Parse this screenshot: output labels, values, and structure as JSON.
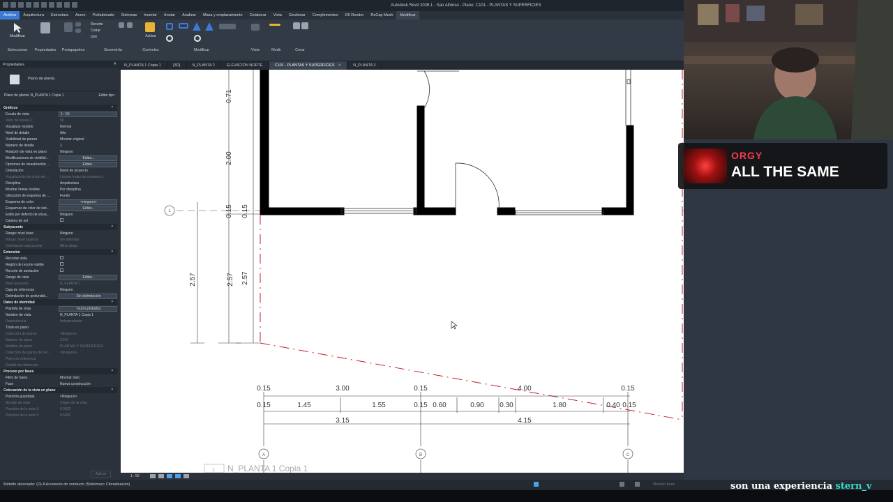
{
  "window": {
    "title": "Autodesk Revit 2026.1 - San Alfonso - Plano: C101 - PLANTAS Y SUPERFICIES"
  },
  "menu": [
    "Archivo",
    "Arquitectura",
    "Estructura",
    "Acero",
    "Prefabricado",
    "Sistemas",
    "Insertar",
    "Anotar",
    "Analizar",
    "Masa y emplazamiento",
    "Colaborar",
    "Vista",
    "Gestionar",
    "Complementos",
    "D5 Render",
    "ReCap Mesh",
    "Modificar"
  ],
  "ribbon": {
    "select": "Seleccionar",
    "modify": "Modificar",
    "properties": "Propiedades",
    "clipboard": "Portapapeles",
    "geometry": "Geometría",
    "controls": "Controles",
    "activate": "Activar",
    "modify_group": "Modificar",
    "view": "Vista",
    "measure": "Medir",
    "create": "Crear",
    "cut_labels": [
      "Recorte",
      "Cortar",
      "Unir"
    ]
  },
  "tabs": [
    {
      "label": "N_PLANTA 1 Copia 1",
      "active": false
    },
    {
      "label": "{3D}",
      "active": false
    },
    {
      "label": "N_PLANTA 2",
      "active": false
    },
    {
      "label": "ELEVACIÓN NORTE",
      "active": false
    },
    {
      "label": "C101 - PLANTAS Y SUPERFICIES",
      "active": true
    },
    {
      "label": "N_PLANTA 3",
      "active": false
    }
  ],
  "properties": {
    "header": "Propiedades",
    "type_name": "Plano de planta",
    "filter": "Plano de planta: N_PLANTA 1 Copia 1",
    "edit_type": "Editar tipo",
    "rows": [
      {
        "cat": "Gráficos"
      },
      {
        "k": "Escala de vista",
        "v": "1 : 50",
        "style": "box"
      },
      {
        "k": "Valor de escala    1:",
        "v": "50",
        "dim": true
      },
      {
        "k": "Visualizar modelo",
        "v": "Normal"
      },
      {
        "k": "Nivel de detalle",
        "v": "Alto"
      },
      {
        "k": "Visibilidad de piezas",
        "v": "Mostrar original"
      },
      {
        "k": "Número de detalle",
        "v": "1"
      },
      {
        "k": "Rotación de vista en plano",
        "v": "Ninguno"
      },
      {
        "k": "Modificaciones de visibilid...",
        "v": "Editar...",
        "style": "btn"
      },
      {
        "k": "Opciones de visualización ...",
        "v": "Editar...",
        "style": "btn"
      },
      {
        "k": "Orientación",
        "v": "Norte de proyecto"
      },
      {
        "k": "Visualización de unión de ...",
        "v": "Limpiar todas las uniones d...",
        "dim": true
      },
      {
        "k": "Disciplina",
        "v": "Arquitectura"
      },
      {
        "k": "Mostrar líneas ocultas",
        "v": "Por disciplina"
      },
      {
        "k": "Ubicación de esquema de ...",
        "v": "Fondo"
      },
      {
        "k": "Esquema de color",
        "v": "<ninguno>",
        "style": "btn"
      },
      {
        "k": "Esquemas de color de sist...",
        "v": "Editar...",
        "style": "btn"
      },
      {
        "k": "Estilo por defecto de visua...",
        "v": "Ninguno"
      },
      {
        "k": "Camino de sol",
        "v": "",
        "style": "chk"
      },
      {
        "cat": "Subyacente"
      },
      {
        "k": "Rango: nivel base",
        "v": "Ninguno"
      },
      {
        "k": "Rango: nivel superior",
        "v": "Sin delimitar",
        "dim": true
      },
      {
        "k": "Orientación subyacente",
        "v": "Mirar abajo",
        "dim": true
      },
      {
        "cat": "Extensión"
      },
      {
        "k": "Recortar vista",
        "v": "",
        "style": "chk"
      },
      {
        "k": "Región de recorte visible",
        "v": "",
        "style": "chk"
      },
      {
        "k": "Recorte de anotación",
        "v": "",
        "style": "chk"
      },
      {
        "k": "Rango de vista",
        "v": "Editar...",
        "style": "btn"
      },
      {
        "k": "Nivel asociado",
        "v": "N_PLANTA 1",
        "dim": true
      },
      {
        "k": "Caja de referencia",
        "v": "Ninguno"
      },
      {
        "k": "Delimitación de profundid...",
        "v": "Sin delimitación",
        "style": "btn"
      },
      {
        "cat": "Datos de identidad"
      },
      {
        "k": "Plantilla de vista",
        "v": "muros pintados",
        "style": "btn"
      },
      {
        "k": "Nombre de vista",
        "v": "N_PLANTA 1 Copia 1"
      },
      {
        "k": "Dependencia",
        "v": "Independiente",
        "dim": true
      },
      {
        "k": "Título en plano",
        "v": ""
      },
      {
        "k": "Colección de planos",
        "v": "<Ninguno>",
        "dim": true
      },
      {
        "k": "Número de plano",
        "v": "C101",
        "dim": true
      },
      {
        "k": "Nombre de plano",
        "v": "PLANTAS Y SUPERFICIES",
        "dim": true
      },
      {
        "k": "Colección de planos de ref...",
        "v": "<Ninguno>",
        "dim": true
      },
      {
        "k": "Plano de referencia",
        "v": "",
        "dim": true
      },
      {
        "k": "Detalle de referencia",
        "v": "",
        "dim": true
      },
      {
        "cat": "Proceso por fases"
      },
      {
        "k": "Filtro de fases",
        "v": "Mostrar todo"
      },
      {
        "k": "Fase",
        "v": "Nueva construcción"
      },
      {
        "cat": "Colocación de la vista en plano"
      },
      {
        "k": "Posición guardada",
        "v": "<Ninguno>"
      },
      {
        "k": "Anclaje de vista",
        "v": "Origen de la vista",
        "dim": true
      },
      {
        "k": "Posición de la vista X",
        "v": "0.0032",
        "dim": true
      },
      {
        "k": "Posición de la vista Y",
        "v": "0.6092",
        "dim": true
      }
    ],
    "apply": "Aplicar"
  },
  "drawing": {
    "dims_vertical": [
      "0.71",
      "2.00",
      "0.15",
      "0.15",
      "2.57",
      "2.57",
      "2.57"
    ],
    "grid_bubbles": [
      "1",
      "1",
      "A",
      "B",
      "C"
    ],
    "dims_row1": [
      "0.15",
      "3.00",
      "0.15",
      "4.00",
      "0.15"
    ],
    "dims_row2": [
      "0.15",
      "1.45",
      "1.55",
      "0.15",
      "0.60",
      "0.90",
      "0.30",
      "1.80",
      "0.40",
      "0.15"
    ],
    "dims_row3": [
      "3.15",
      "4.15"
    ],
    "view_title_num": "1",
    "view_title": "N_PLANTA 1 Copia 1"
  },
  "viewbar": {
    "scale": "1 : 50"
  },
  "status": {
    "text": "Método abreviado: (D) A Accesorio de conducto (Sistemas> Climatización)",
    "model": "Modelo base"
  },
  "overlay": {
    "artist": "ORGY",
    "song": "ALL THE SAME"
  },
  "caption": {
    "text": "son una experiencia ",
    "name": "stern_v"
  }
}
